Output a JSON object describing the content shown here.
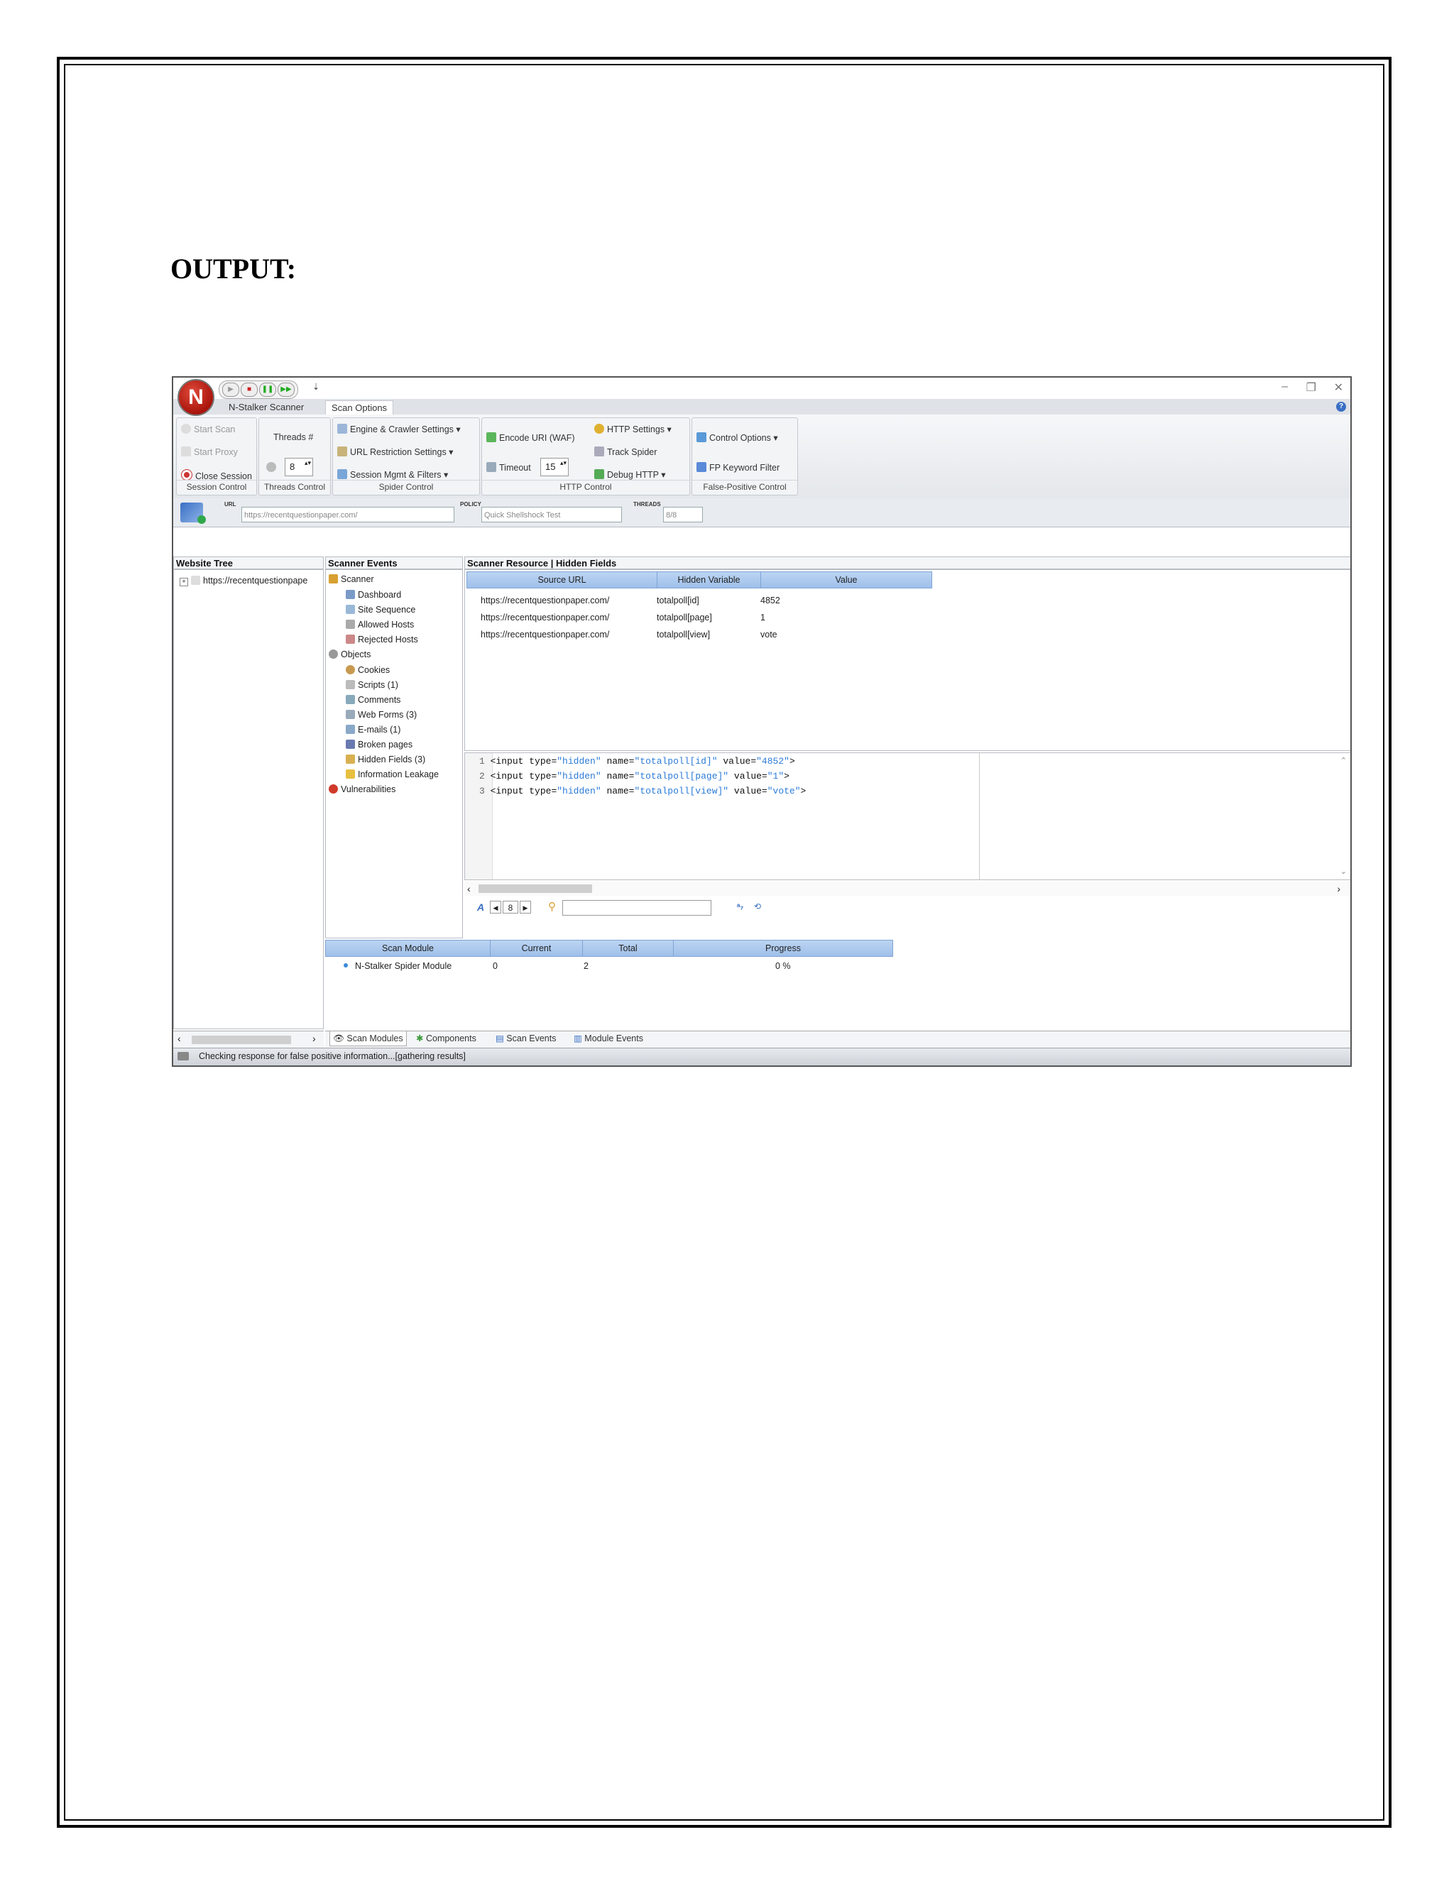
{
  "document": {
    "heading": "OUTPUT:"
  },
  "app": {
    "tabs": [
      "N-Stalker Scanner",
      "Scan Options"
    ],
    "ribbon": {
      "session": {
        "start_scan": "Start Scan",
        "start_proxy": "Start Proxy",
        "close_session": "Close Session",
        "label": "Session Control"
      },
      "threads": {
        "title": "Threads #",
        "value": "8",
        "label": "Threads Control"
      },
      "spider": {
        "engine": "Engine & Crawler Settings",
        "url_restriction": "URL Restriction Settings",
        "session_mgmt": "Session Mgmt & Filters",
        "label": "Spider Control"
      },
      "http": {
        "encode_uri": "Encode URI (WAF)",
        "timeout_label": "Timeout",
        "timeout_value": "15",
        "http_settings": "HTTP Settings",
        "track_spider": "Track Spider",
        "debug_http": "Debug HTTP",
        "label": "HTTP Control"
      },
      "fp": {
        "control_options": "Control Options",
        "fp_keyword": "FP Keyword Filter",
        "label": "False-Positive Control"
      }
    },
    "urlbar": {
      "url_label": "URL",
      "url_value": "https://recentquestionpaper.com/",
      "policy_label": "POLICY",
      "policy_value": "Quick Shellshock Test",
      "threads_label": "THREADS",
      "threads_value": "8/8"
    },
    "website_tree": {
      "title": "Website Tree",
      "root": "https://recentquestionpape"
    },
    "scanner_events": {
      "title": "Scanner Events",
      "scanner": "Scanner",
      "scanner_items": [
        "Dashboard",
        "Site Sequence",
        "Allowed Hosts",
        "Rejected Hosts"
      ],
      "objects": "Objects",
      "object_items": [
        "Cookies",
        "Scripts (1)",
        "Comments",
        "Web Forms (3)",
        "E-mails (1)",
        "Broken pages",
        "Hidden Fields (3)",
        "Information Leakage"
      ],
      "vulnerabilities": "Vulnerabilities"
    },
    "resource": {
      "title": "Scanner Resource | Hidden Fields",
      "columns": [
        "Source URL",
        "Hidden Variable",
        "Value"
      ],
      "rows": [
        [
          "https://recentquestionpaper.com/",
          "totalpoll[id]",
          "4852"
        ],
        [
          "https://recentquestionpaper.com/",
          "totalpoll[page]",
          "1"
        ],
        [
          "https://recentquestionpaper.com/",
          "totalpoll[view]",
          "vote"
        ]
      ]
    },
    "source_view": {
      "lines": [
        {
          "num": "1",
          "a": "<input type=",
          "b": "\"hidden\"",
          "c": " name=",
          "d": "\"totalpoll[id]\"",
          "e": " value=",
          "f": "\"4852\"",
          "g": ">"
        },
        {
          "num": "2",
          "a": "<input type=",
          "b": "\"hidden\"",
          "c": " name=",
          "d": "\"totalpoll[page]\"",
          "e": " value=",
          "f": "\"1\"",
          "g": ">"
        },
        {
          "num": "3",
          "a": "<input type=",
          "b": "\"hidden\"",
          "c": " name=",
          "d": "\"totalpoll[view]\"",
          "e": " value=",
          "f": "\"vote\"",
          "g": ">"
        }
      ],
      "page_number": "8"
    },
    "modules": {
      "columns": [
        "Scan Module",
        "Current",
        "Total",
        "Progress"
      ],
      "rows": [
        {
          "name": "N-Stalker Spider Module",
          "current": "0",
          "total": "2",
          "progress": "0 %"
        }
      ]
    },
    "bottom_tabs": [
      "Scan Modules",
      "Components",
      "Scan Events",
      "Module Events"
    ],
    "status": "Checking response for false positive information...[gathering results]"
  }
}
